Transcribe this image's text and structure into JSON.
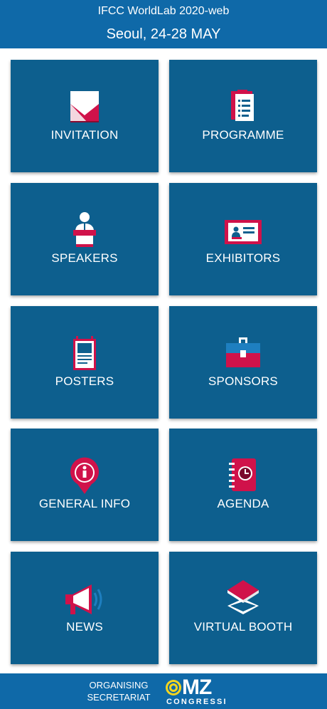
{
  "header": {
    "app_title": "IFCC WorldLab 2020-web",
    "event_date": "Seoul, 24-28 MAY"
  },
  "colors": {
    "header_blue": "#0f69a8",
    "tile_blue": "#0d5f8e",
    "accent_red": "#d0124a"
  },
  "tiles": [
    {
      "label": "INVITATION",
      "icon": "envelope-icon"
    },
    {
      "label": "PROGRAMME",
      "icon": "clipboard-icon"
    },
    {
      "label": "SPEAKERS",
      "icon": "speaker-podium-icon"
    },
    {
      "label": "EXHIBITORS",
      "icon": "exhibitor-booth-icon"
    },
    {
      "label": "POSTERS",
      "icon": "poster-icon"
    },
    {
      "label": "SPONSORS",
      "icon": "briefcase-icon"
    },
    {
      "label": "GENERAL INFO",
      "icon": "info-pin-icon"
    },
    {
      "label": "AGENDA",
      "icon": "agenda-clock-icon"
    },
    {
      "label": "NEWS",
      "icon": "megaphone-icon"
    },
    {
      "label": "VIRTUAL BOOTH",
      "icon": "layers-icon"
    }
  ],
  "footer": {
    "organising_line1": "ORGANISING",
    "organising_line2": "SECRETARIAT",
    "logo_main": "MZ",
    "logo_sub": "CONGRESSI"
  }
}
